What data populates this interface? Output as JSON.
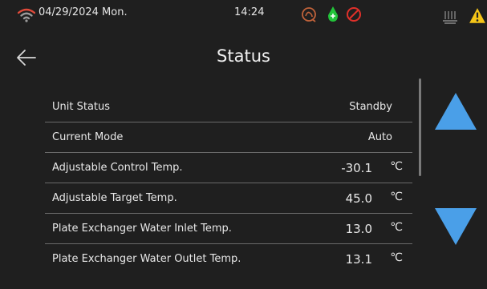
{
  "statusbar": {
    "date": "04/29/2024 Mon.",
    "time": "14:24",
    "icons": [
      "wifi-icon",
      "compressor-icon",
      "water-pump-icon",
      "stop-icon",
      "heater-icon",
      "warning-icon"
    ]
  },
  "header": {
    "title": "Status",
    "back_icon": "back-arrow-icon"
  },
  "rows": [
    {
      "label": "Unit Status",
      "value": "Standby",
      "unit": ""
    },
    {
      "label": "Current Mode",
      "value": "Auto",
      "unit": ""
    },
    {
      "label": "Adjustable Control Temp.",
      "value": "-30.1",
      "unit": "℃"
    },
    {
      "label": "Adjustable Target Temp.",
      "value": "45.0",
      "unit": "℃"
    },
    {
      "label": "Plate Exchanger Water Inlet Temp.",
      "value": "13.0",
      "unit": "℃"
    },
    {
      "label": "Plate Exchanger Water Outlet Temp.",
      "value": "13.1",
      "unit": "℃"
    }
  ],
  "nav": {
    "up_icon": "arrow-up-icon",
    "down_icon": "arrow-down-icon"
  },
  "colors": {
    "background": "#1f1f1f",
    "accent_blue": "#4a9fe8",
    "pump_green": "#22c43a",
    "stop_red": "#e0302a",
    "warning_yellow": "#f5c518",
    "compressor_orange": "#c0623a"
  }
}
